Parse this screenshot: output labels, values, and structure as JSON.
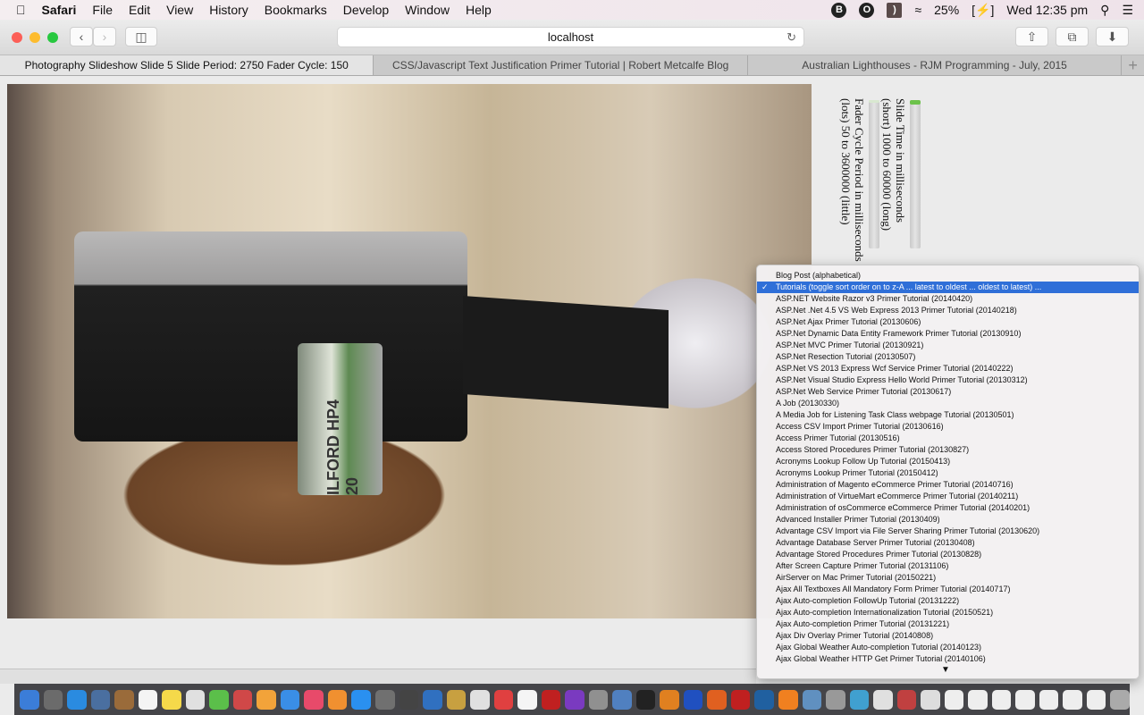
{
  "menubar": {
    "app": "Safari",
    "items": [
      "File",
      "Edit",
      "View",
      "History",
      "Bookmarks",
      "Develop",
      "Window",
      "Help"
    ],
    "battery": "25%",
    "clock": "Wed 12:35 pm"
  },
  "toolbar": {
    "url": "localhost"
  },
  "tabs": [
    {
      "label": "Photography Slideshow Slide 5 Slide Period: 2750 Fader Cycle: 150",
      "active": true
    },
    {
      "label": "CSS/Javascript Text Justification Primer Tutorial | Robert Metcalfe Blog",
      "active": false
    },
    {
      "label": "Australian Lighthouses - RJM Programming - July, 2015",
      "active": false
    }
  ],
  "photo": {
    "film_label": "ILFORD HP4 20"
  },
  "controls": {
    "slide_time": {
      "line1": "Slide Time in milliseconds",
      "line2": "(short) 1000 to 60000 (long)",
      "fill_fraction": 0.03
    },
    "fader": {
      "line1": "Fader Cycle Period in milliseconds",
      "line2": "(lots) 50 to 3600000 (little)",
      "fill_fraction": 0.0
    }
  },
  "dropdown": {
    "selected_index": 1,
    "options": [
      "Blog Post (alphabetical)",
      "Tutorials (toggle sort order on to z-A ... latest to oldest ... oldest to latest) ...",
      "ASP.NET Website Razor v3 Primer Tutorial (20140420)",
      "ASP.Net .Net 4.5 VS Web Express 2013 Primer Tutorial (20140218)",
      "ASP.Net Ajax Primer Tutorial (20130606)",
      "ASP.Net Dynamic Data Entity Framework Primer Tutorial (20130910)",
      "ASP.Net MVC Primer Tutorial (20130921)",
      "ASP.Net Resection Tutorial (20130507)",
      "ASP.Net VS 2013 Express Wcf Service Primer Tutorial (20140222)",
      "ASP.Net Visual Studio Express Hello World Primer Tutorial (20130312)",
      "ASP.Net Web Service Primer Tutorial (20130617)",
      "A Job (20130330)",
      "A Media Job for Listening Task Class webpage Tutorial (20130501)",
      "Access CSV Import Primer Tutorial (20130616)",
      "Access Primer Tutorial (20130516)",
      "Access Stored Procedures Primer Tutorial (20130827)",
      "Acronyms Lookup Follow Up Tutorial (20150413)",
      "Acronyms Lookup Primer Tutorial (20150412)",
      "Administration of Magento eCommerce Primer Tutorial (20140716)",
      "Administration of VirtueMart eCommerce Primer Tutorial (20140211)",
      "Administration of osCommerce eCommerce Primer Tutorial (20140201)",
      "Advanced Installer Primer Tutorial (20130409)",
      "Advantage CSV Import via File Server Sharing Primer Tutorial (20130620)",
      "Advantage Database Server Primer Tutorial (20130408)",
      "Advantage Stored Procedures Primer Tutorial (20130828)",
      "After Screen Capture Primer Tutorial (20131106)",
      "AirServer on Mac Primer Tutorial (20150221)",
      "Ajax All Textboxes All Mandatory Form Primer Tutorial (20140717)",
      "Ajax Auto-completion FollowUp Tutorial (20131222)",
      "Ajax Auto-completion Internationalization Tutorial (20150521)",
      "Ajax Auto-completion Primer Tutorial (20131221)",
      "Ajax Div Overlay Primer Tutorial (20140808)",
      "Ajax Global Weather Auto-completion Tutorial (20140123)",
      "Ajax Global Weather HTTP Get Primer Tutorial (20140106)"
    ]
  },
  "dock": {
    "colors": [
      "#3b7dd8",
      "#6b6b6b",
      "#2a8be0",
      "#4a6fa0",
      "#9a6b3a",
      "#f4f4f4",
      "#f5d94a",
      "#e0e0e0",
      "#5bbf4a",
      "#d04848",
      "#f2a33a",
      "#3a8ee6",
      "#e84a6a",
      "#f09030",
      "#2a90f0",
      "#707070",
      "#444",
      "#3070c0",
      "#c8a040",
      "#e0e0e0",
      "#e04040",
      "#f5f5f5",
      "#c02020",
      "#7a3ac0",
      "#909090",
      "#5080c0",
      "#222",
      "#e08020",
      "#2050c0",
      "#e06020",
      "#c02020",
      "#2060a0",
      "#f08020",
      "#6090c0",
      "#999",
      "#40a0d0",
      "#e0e0e0",
      "#c04040",
      "#ddd",
      "#eee",
      "#eee",
      "#eee",
      "#eee",
      "#eee",
      "#eee",
      "#eee",
      "#aaa"
    ]
  }
}
